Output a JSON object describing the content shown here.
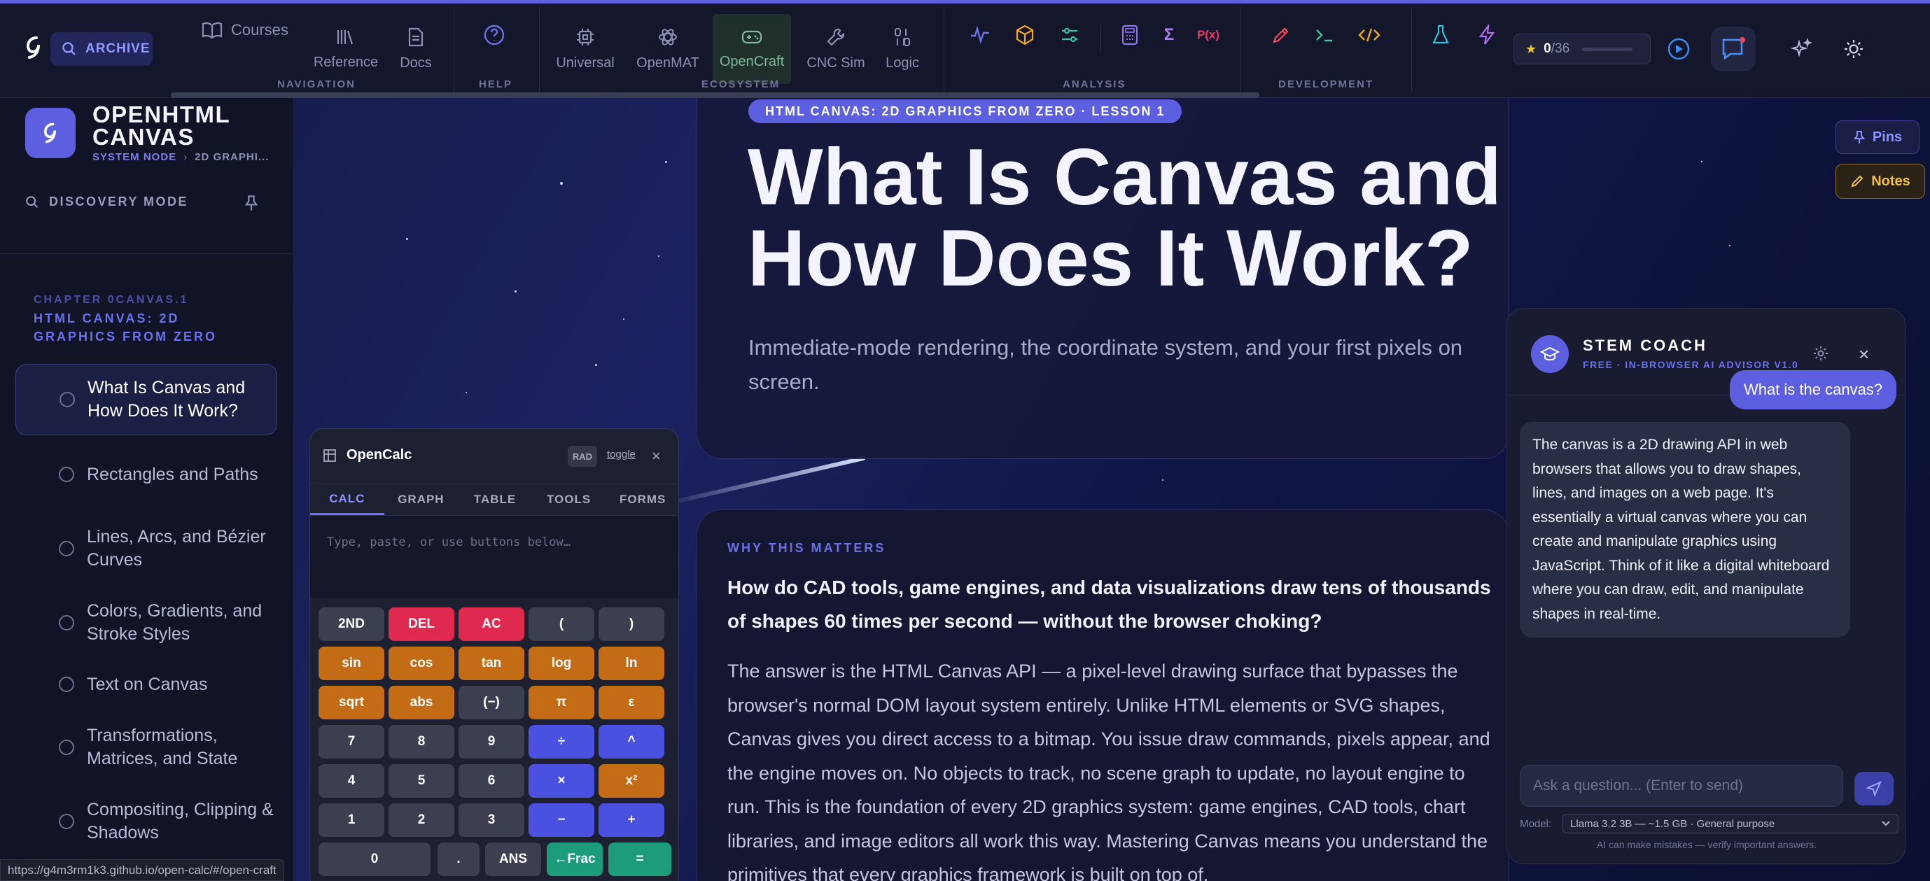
{
  "nav": {
    "archive_label": "ARCHIVE",
    "courses_label": "Courses",
    "items": [
      {
        "label": "Reference"
      },
      {
        "label": "Docs"
      },
      {
        "label": "Universal"
      },
      {
        "label": "OpenMAT"
      },
      {
        "label": "OpenCraft"
      },
      {
        "label": "CNC Sim"
      },
      {
        "label": "Logic"
      }
    ],
    "groups": [
      "NAVIGATION",
      "HELP",
      "ECOSYSTEM",
      "ANALYSIS",
      "DEVELOPMENT"
    ],
    "star_score": "0",
    "star_total": "/36",
    "star_progress": 0,
    "accent": "#5b5fe0"
  },
  "sidebar": {
    "title": "OPENHTML CANVAS",
    "crumb_a": "SYSTEM NODE",
    "crumb_sep": "›",
    "crumb_b": "2D GRAPHI...",
    "discovery": "DISCOVERY MODE",
    "chapter": "CHAPTER 0CANVAS.1",
    "chapter_title": "HTML CANVAS: 2D GRAPHICS FROM ZERO",
    "lessons": [
      {
        "label": "What Is Canvas and How Does It Work?"
      },
      {
        "label": "Rectangles and Paths"
      },
      {
        "label": "Lines, Arcs, and Bézier Curves"
      },
      {
        "label": "Colors, Gradients, and Stroke Styles"
      },
      {
        "label": "Text on Canvas"
      },
      {
        "label": "Transformations, Matrices, and State"
      },
      {
        "label": "Compositing, Clipping & Shadows"
      }
    ]
  },
  "lesson": {
    "badge": "HTML CANVAS: 2D GRAPHICS FROM ZERO · LESSON 1",
    "title": "What Is Canvas and How Does It Work?",
    "subtitle": "Immediate-mode rendering, the coordinate system, and your first pixels on screen.",
    "why_label": "WHY THIS MATTERS",
    "question": "How do CAD tools, game engines, and data visualizations draw tens of thousands of shapes 60 times per second — without the browser choking?",
    "body": "The answer is the HTML Canvas API — a pixel-level drawing surface that bypasses the browser's normal DOM layout system entirely. Unlike HTML elements or SVG shapes, Canvas gives you direct access to a bitmap. You issue draw commands, pixels appear, and the engine moves on. No objects to track, no scene graph to update, no layout engine to run. This is the foundation of every 2D graphics system: game engines, CAD tools, chart libraries, and image editors all work this way. Mastering Canvas means you understand the primitives that every graphics framework is built on top of."
  },
  "side_buttons": {
    "pins": "Pins",
    "notes": "Notes"
  },
  "calc": {
    "title": "OpenCalc",
    "mode": "RAD",
    "toggle": "toggle",
    "tabs": [
      "CALC",
      "GRAPH",
      "TABLE",
      "TOOLS",
      "FORMS"
    ],
    "placeholder": "Type, paste, or use buttons below…",
    "keys": [
      [
        "2ND",
        "DEL",
        "AC",
        "(",
        ")"
      ],
      [
        "sin",
        "cos",
        "tan",
        "log",
        "ln"
      ],
      [
        "sqrt",
        "abs",
        "(−)",
        "π",
        "ε"
      ],
      [
        "7",
        "8",
        "9",
        "÷",
        "^"
      ],
      [
        "4",
        "5",
        "6",
        "×",
        "x²"
      ],
      [
        "1",
        "2",
        "3",
        "−",
        "+"
      ],
      [
        "0",
        ".",
        "ANS",
        "←Frac",
        "="
      ]
    ]
  },
  "coach": {
    "title": "STEM COACH",
    "subtitle": "FREE · IN-BROWSER AI ADVISOR V1.0",
    "user_msg": "What is the canvas?",
    "bot_msg": "The canvas is a 2D drawing API in web browsers that allows you to draw shapes, lines, and images on a web page. It's essentially a virtual canvas where you can create and manipulate graphics using JavaScript. Think of it like a digital whiteboard where you can draw, edit, and manipulate shapes in real-time.",
    "input_placeholder": "Ask a question... (Enter to send)",
    "model_label": "Model:",
    "model_value": "Llama 3.2 3B — ~1.5 GB · General purpose",
    "warning": "AI can make mistakes — verify important answers."
  },
  "status_url": "https://g4m3rm1k3.github.io/open-calc/#/open-craft"
}
